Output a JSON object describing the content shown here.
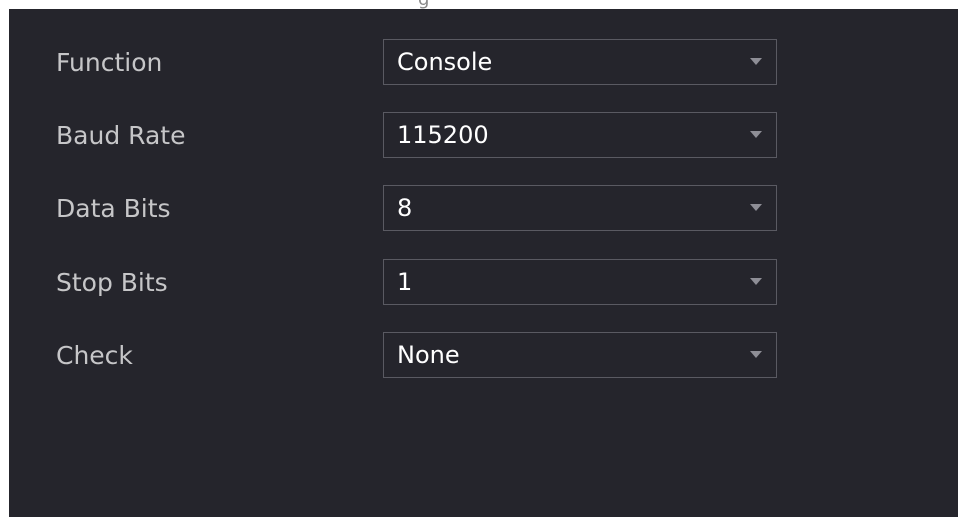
{
  "window": {
    "title_fragment": "g"
  },
  "form": {
    "rows": [
      {
        "label": "Function",
        "value": "Console"
      },
      {
        "label": "Baud Rate",
        "value": "115200"
      },
      {
        "label": "Data Bits",
        "value": "8"
      },
      {
        "label": "Stop Bits",
        "value": "1"
      },
      {
        "label": "Check",
        "value": "None"
      }
    ]
  },
  "icons": {
    "dropdown": "chevron-down-icon"
  },
  "colors": {
    "panel_bg": "#25252c",
    "label_text": "#c6c6c8",
    "value_text": "#ffffff",
    "field_border": "#5a5a62",
    "caret": "#8e8e96"
  }
}
